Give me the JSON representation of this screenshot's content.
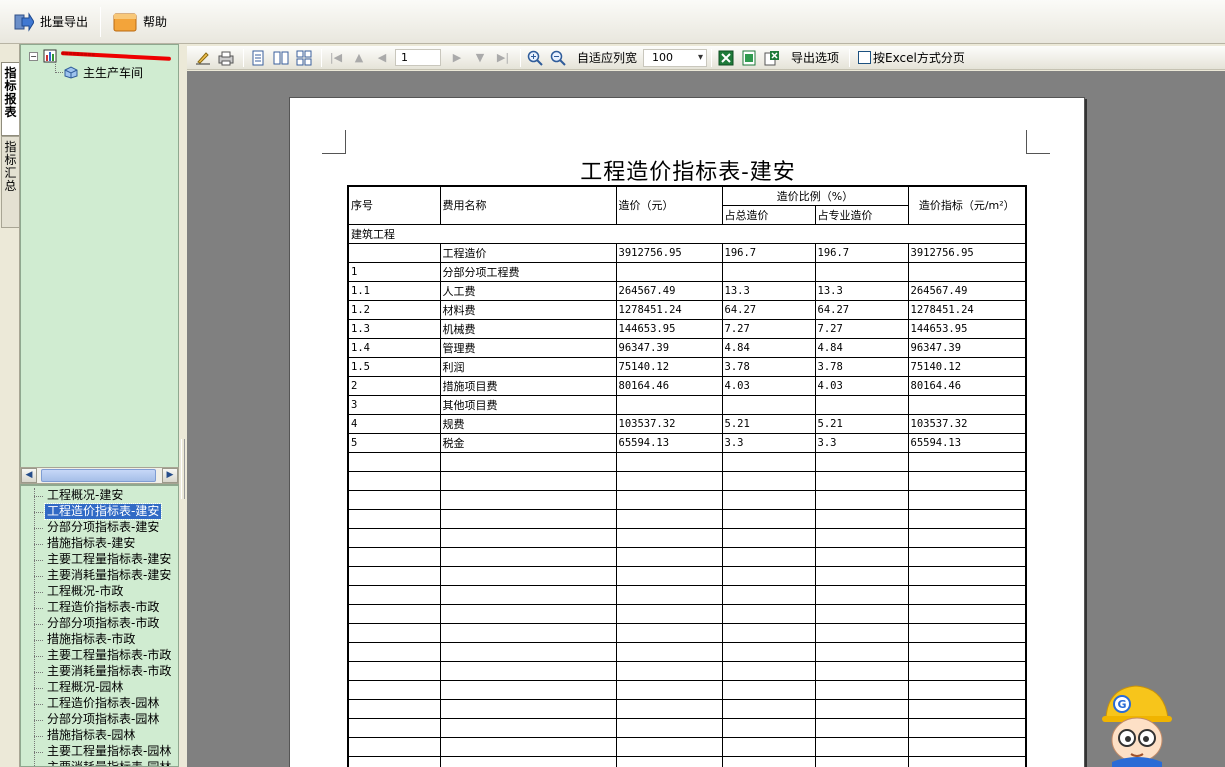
{
  "toolbar": {
    "batch_export": "批量导出",
    "help": "帮助"
  },
  "side_tabs": {
    "active": "指标报表",
    "inactive": "指标汇总"
  },
  "tree": {
    "root_label": "■■■■■■■■■",
    "child_label": "主生产车间"
  },
  "report_list": [
    "工程概况-建安",
    "工程造价指标表-建安",
    "分部分项指标表-建安",
    "措施指标表-建安",
    "主要工程量指标表-建安",
    "主要消耗量指标表-建安",
    "工程概况-市政",
    "工程造价指标表-市政",
    "分部分项指标表-市政",
    "措施指标表-市政",
    "主要工程量指标表-市政",
    "主要消耗量指标表-市政",
    "工程概况-园林",
    "工程造价指标表-园林",
    "分部分项指标表-园林",
    "措施指标表-园林",
    "主要工程量指标表-园林",
    "主要消耗量指标表-园林"
  ],
  "selected_report_index": 1,
  "preview_toolbar": {
    "page_number": "1",
    "fit_width": "自适应列宽",
    "zoom": "100",
    "export_options": "导出选项",
    "excel_pagination": "按Excel方式分页"
  },
  "report": {
    "title": "工程造价指标表-建安",
    "headers": {
      "seq": "序号",
      "name": "费用名称",
      "cost": "造价（元）",
      "ratio": "造价比例（%）",
      "ratio_total": "占总造价",
      "ratio_specialty": "占专业造价",
      "index": "造价指标（元/m²）"
    },
    "section": "建筑工程",
    "rows": [
      [
        "",
        "工程造价",
        "3912756.95",
        "196.7",
        "196.7",
        "3912756.95"
      ],
      [
        "1",
        "分部分项工程费",
        "",
        "",
        "",
        ""
      ],
      [
        "1.1",
        "人工费",
        "264567.49",
        "13.3",
        "13.3",
        "264567.49"
      ],
      [
        "1.2",
        "材料费",
        "1278451.24",
        "64.27",
        "64.27",
        "1278451.24"
      ],
      [
        "1.3",
        "机械费",
        "144653.95",
        "7.27",
        "7.27",
        "144653.95"
      ],
      [
        "1.4",
        "管理费",
        "96347.39",
        "4.84",
        "4.84",
        "96347.39"
      ],
      [
        "1.5",
        "利润",
        "75140.12",
        "3.78",
        "3.78",
        "75140.12"
      ],
      [
        "2",
        "措施项目费",
        "80164.46",
        "4.03",
        "4.03",
        "80164.46"
      ],
      [
        "3",
        "其他项目费",
        "",
        "",
        "",
        ""
      ],
      [
        "4",
        "规费",
        "103537.32",
        "5.21",
        "5.21",
        "103537.32"
      ],
      [
        "5",
        "税金",
        "65594.13",
        "3.3",
        "3.3",
        "65594.13"
      ]
    ]
  },
  "mascot": {
    "badge": "G"
  }
}
